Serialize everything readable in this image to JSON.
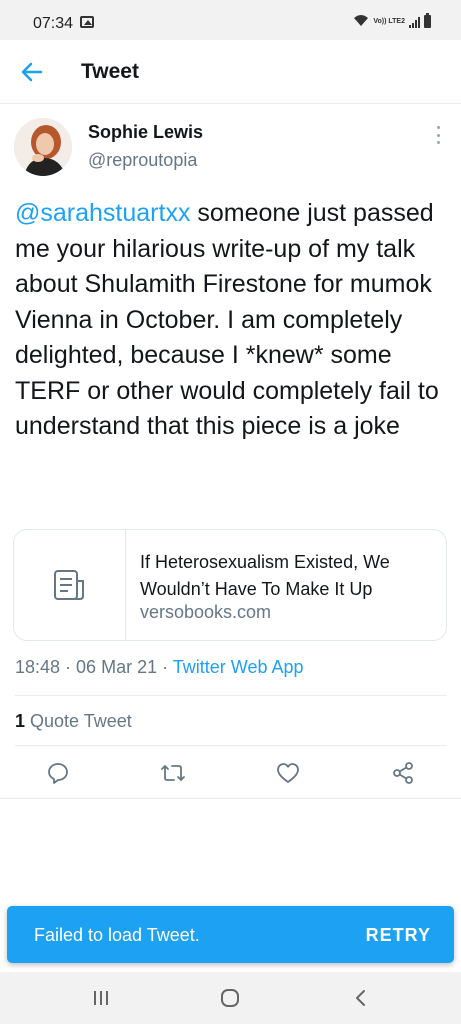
{
  "status_bar": {
    "time": "07:34",
    "network": "Vo)) LTE2",
    "icons": [
      "gallery-icon",
      "wifi-icon",
      "signal-icon",
      "battery-icon"
    ]
  },
  "app_bar": {
    "title": "Tweet",
    "back_icon": "arrow-left-icon"
  },
  "tweet": {
    "author_name": "Sophie Lewis",
    "author_handle": "@reproutopia",
    "mention": "@sarahstuartxx",
    "text": " someone just passed me your hilarious write-up of my talk about Shulamith Firestone for mumok Vienna in October. I am completely delighted, because I *knew* some TERF or other would completely fail to understand that this piece is a joke",
    "card": {
      "title": "If Heterosexualism Existed, We Wouldn’t Have To Make It Up",
      "domain": "versobooks.com",
      "icon": "article-icon"
    },
    "time": "18:48",
    "date": "06 Mar 21",
    "separator": " · ",
    "source": "Twitter Web App",
    "quote_count": "1",
    "quote_label": " Quote Tweet"
  },
  "actions": [
    "reply-icon",
    "retweet-icon",
    "like-icon",
    "share-icon"
  ],
  "snackbar": {
    "message": "Failed to load Tweet.",
    "action": "RETRY"
  },
  "colors": {
    "accent": "#1da1f2",
    "secondary_text": "#657786",
    "primary_text": "#14171a",
    "divider": "#e6ecf0"
  },
  "nav_bar": [
    "recents-icon",
    "home-icon",
    "back-icon"
  ]
}
